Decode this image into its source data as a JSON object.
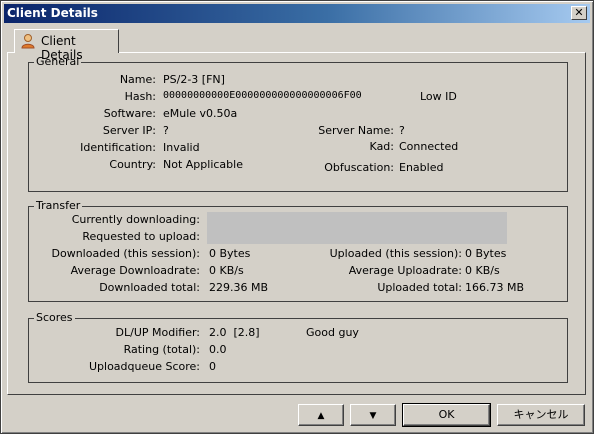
{
  "window": {
    "title": "Client Details",
    "close_glyph": "✕"
  },
  "tab": {
    "label": "Client Details",
    "icon": "user-icon"
  },
  "general": {
    "legend": "General",
    "name_label": "Name:",
    "name_value": "PS/2-3 [FN]",
    "hash_label": "Hash:",
    "hash_value": "00000000000E000000000000000006F00",
    "id_status": "Low ID",
    "software_label": "Software:",
    "software_value": "eMule v0.50a",
    "server_ip_label": "Server IP:",
    "server_ip_value": "?",
    "server_name_label": "Server Name:",
    "server_name_value": "?",
    "identification_label": "Identification:",
    "identification_value": "Invalid",
    "kad_label": "Kad:",
    "kad_value": "Connected",
    "country_label": "Country:",
    "country_value": "Not Applicable",
    "obfuscation_label": "Obfuscation:",
    "obfuscation_value": "Enabled"
  },
  "transfer": {
    "legend": "Transfer",
    "currently_downloading_label": "Currently downloading:",
    "requested_to_upload_label": "Requested to upload:",
    "downloaded_session_label": "Downloaded (this session):",
    "downloaded_session_value": "0 Bytes",
    "uploaded_session_label": "Uploaded (this session):",
    "uploaded_session_value": "0 Bytes",
    "avg_down_label": "Average Downloadrate:",
    "avg_down_value": "0 KB/s",
    "avg_up_label": "Average Uploadrate:",
    "avg_up_value": "0 KB/s",
    "down_total_label": "Downloaded total:",
    "down_total_value": "229.36 MB",
    "up_total_label": "Uploaded total:",
    "up_total_value": "166.73 MB"
  },
  "scores": {
    "legend": "Scores",
    "modifier_label": "DL/UP Modifier:",
    "modifier_value": "2.0  [2.8]",
    "rating_note": "Good guy",
    "rating_label": "Rating (total):",
    "rating_value": "0.0",
    "queue_label": "Uploadqueue Score:",
    "queue_value": "0"
  },
  "buttons": {
    "prev": "▲",
    "next": "▼",
    "ok": "OK",
    "cancel": "キャンセル"
  }
}
